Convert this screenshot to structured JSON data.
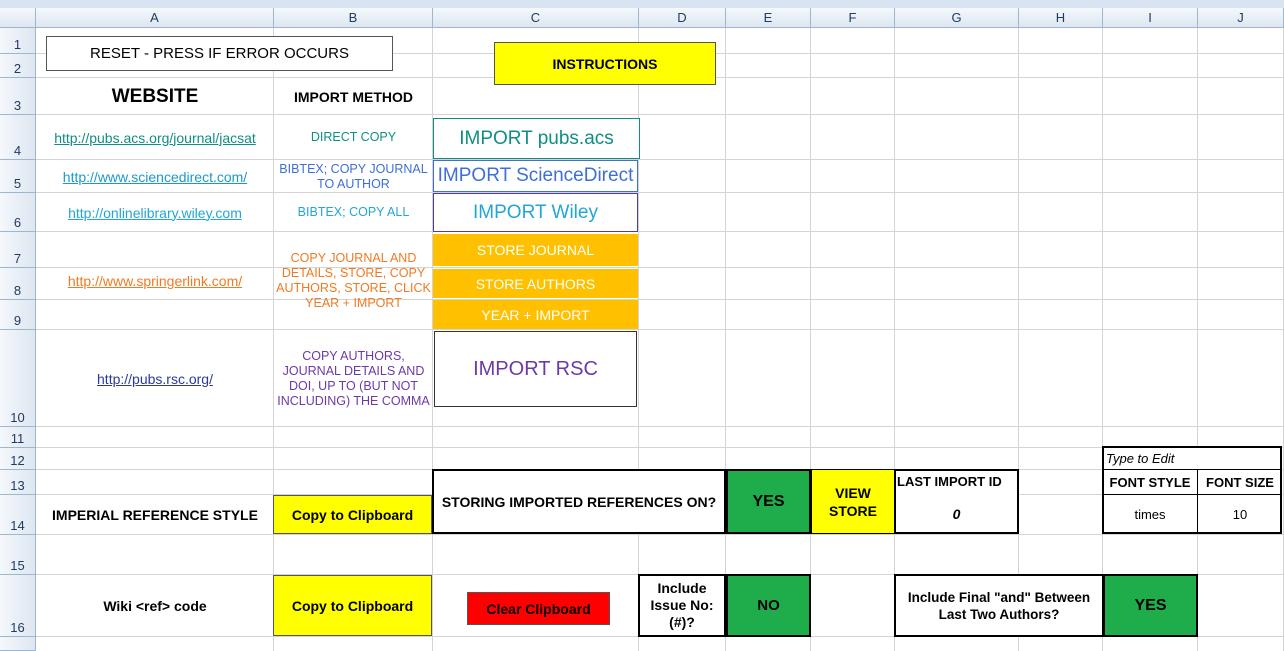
{
  "columns": [
    "A",
    "B",
    "C",
    "D",
    "E",
    "F",
    "G",
    "H",
    "I",
    "J"
  ],
  "rows": [
    "1",
    "2",
    "3",
    "4",
    "5",
    "6",
    "7",
    "8",
    "9",
    "10",
    "11",
    "12",
    "13",
    "14",
    "15",
    "16"
  ],
  "reset_button": "RESET  - PRESS IF ERROR OCCURS",
  "instructions_button": "INSTRUCTIONS",
  "headers": {
    "website": "WEBSITE",
    "import_method": "IMPORT METHOD"
  },
  "sites": [
    {
      "url": "http://pubs.acs.org/journal/jacsat",
      "method": "DIRECT COPY",
      "button": "IMPORT pubs.acs"
    },
    {
      "url": "http://www.sciencedirect.com/",
      "method": "BIBTEX; COPY JOURNAL TO AUTHOR",
      "button": "IMPORT ScienceDirect"
    },
    {
      "url": "http://onlinelibrary.wiley.com",
      "method": "BIBTEX; COPY ALL",
      "button": "IMPORT Wiley"
    },
    {
      "url": "http://www.springerlink.com/",
      "method": "COPY JOURNAL AND DETAILS, STORE, COPY AUTHORS, STORE, CLICK YEAR + IMPORT",
      "buttons": [
        "STORE JOURNAL",
        "STORE AUTHORS",
        "YEAR + IMPORT"
      ]
    },
    {
      "url": "http://pubs.rsc.org/",
      "method": "COPY AUTHORS, JOURNAL DETAILS AND DOI, UP TO (BUT NOT INCLUDING) THE COMMA",
      "button": "IMPORT RSC"
    }
  ],
  "imperial": {
    "label": "IMPERIAL REFERENCE STYLE",
    "copy_button": "Copy to Clipboard"
  },
  "storing": {
    "label": "STORING IMPORTED REFERENCES ON?",
    "value": "YES",
    "view_store": "VIEW STORE"
  },
  "last_import": {
    "label": "LAST IMPORT ID",
    "value": "0"
  },
  "font_settings": {
    "hint": "Type to Edit",
    "style_label": "FONT STYLE",
    "size_label": "FONT SIZE",
    "style_value": "times",
    "size_value": "10"
  },
  "wiki": {
    "label": "Wiki <ref> code",
    "copy_button": "Copy to Clipboard",
    "clear_button": "Clear Clipboard"
  },
  "issue": {
    "label": "Include Issue No: (#)?",
    "value": "NO"
  },
  "final_and": {
    "label": "Include Final \"and\" Between Last Two Authors?",
    "value": "YES"
  },
  "colors": {
    "yellow": "#ffff00",
    "green": "#1fad4c",
    "orange": "#ffc000",
    "red": "#ff0000",
    "acs": "#0f8f82",
    "sd": "#3d6fd6",
    "wiley": "#22a6d6",
    "springer": "#f07a22",
    "rsc": "#6c3aa8"
  }
}
